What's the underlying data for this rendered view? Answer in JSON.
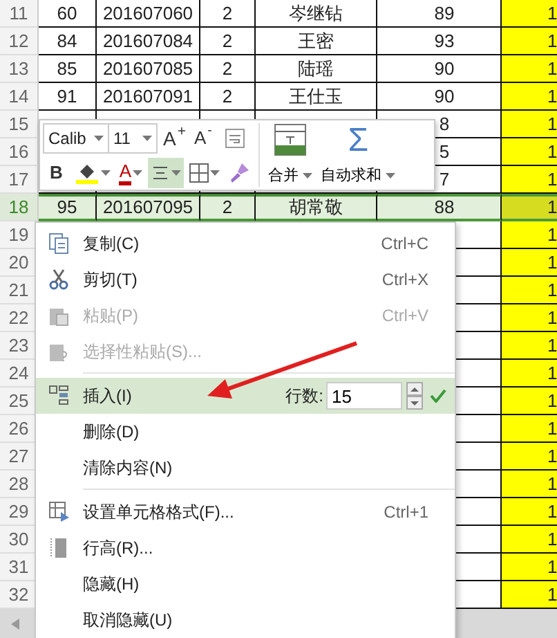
{
  "sheet": {
    "rows": [
      {
        "number": "11",
        "selected": false,
        "cells": {
          "a": "60",
          "b": "201607060",
          "c": "2",
          "d": "岑继钻",
          "e": "89",
          "f": "1"
        }
      },
      {
        "number": "12",
        "selected": false,
        "cells": {
          "a": "84",
          "b": "201607084",
          "c": "2",
          "d": "王密",
          "e": "93",
          "f": "1"
        }
      },
      {
        "number": "13",
        "selected": false,
        "cells": {
          "a": "85",
          "b": "201607085",
          "c": "2",
          "d": "陆瑶",
          "e": "90",
          "f": "1"
        }
      },
      {
        "number": "14",
        "selected": false,
        "cells": {
          "a": "91",
          "b": "201607091",
          "c": "2",
          "d": "王仕玉",
          "e": "90",
          "f": "1"
        }
      },
      {
        "number": "15",
        "selected": false,
        "cells": {
          "e": "8",
          "f": "1"
        }
      },
      {
        "number": "16",
        "selected": false,
        "cells": {
          "e": "5",
          "f": "1"
        }
      },
      {
        "number": "17",
        "selected": false,
        "cells": {
          "e": "7",
          "f": "1"
        }
      },
      {
        "number": "18",
        "selected": true,
        "cells": {
          "a": "95",
          "b": "201607095",
          "c": "2",
          "d": "胡常敬",
          "e": "88",
          "f": "1"
        }
      },
      {
        "number": "19",
        "selected": false,
        "cells": {
          "f": "1"
        }
      },
      {
        "number": "20",
        "selected": false,
        "cells": {
          "f": "1"
        }
      },
      {
        "number": "21",
        "selected": false,
        "cells": {
          "f": "1"
        }
      },
      {
        "number": "22",
        "selected": false,
        "cells": {
          "f": "1"
        }
      },
      {
        "number": "23",
        "selected": false,
        "cells": {
          "f": "1"
        }
      },
      {
        "number": "24",
        "selected": false,
        "cells": {
          "f": "1"
        }
      },
      {
        "number": "25",
        "selected": false,
        "cells": {
          "f": "1"
        }
      },
      {
        "number": "26",
        "selected": false,
        "cells": {
          "f": "1"
        }
      },
      {
        "number": "27",
        "selected": false,
        "cells": {
          "f": "1"
        }
      },
      {
        "number": "28",
        "selected": false,
        "cells": {
          "f": "1"
        }
      },
      {
        "number": "29",
        "selected": false,
        "cells": {
          "f": "1"
        }
      },
      {
        "number": "30",
        "selected": false,
        "cells": {
          "f": "1"
        }
      },
      {
        "number": "31",
        "selected": false,
        "cells": {
          "f": "1"
        }
      },
      {
        "number": "32",
        "selected": false,
        "cells": {
          "f": "1"
        }
      }
    ]
  },
  "toolbar": {
    "font_name": "Calib",
    "font_size": "11",
    "grow_font": "A$^{+}$",
    "shrink_font": "A$^{-}$",
    "bold": "B",
    "font_color": "A",
    "align_selected": true,
    "merge": "合并",
    "autosum_symbol": "Σ",
    "autosum": "自动求和"
  },
  "context_menu": {
    "items": [
      {
        "kind": "item",
        "label": "复制(C)",
        "shortcut": "Ctrl+C",
        "disabled": false,
        "selected": false
      },
      {
        "kind": "item",
        "label": "剪切(T)",
        "shortcut": "Ctrl+X",
        "disabled": false,
        "selected": false
      },
      {
        "kind": "item",
        "label": "粘贴(P)",
        "shortcut": "Ctrl+V",
        "disabled": true,
        "selected": false
      },
      {
        "kind": "item",
        "label": "选择性粘贴(S)...",
        "disabled": true,
        "selected": false
      },
      {
        "kind": "separator"
      },
      {
        "kind": "count",
        "label": "插入(I)",
        "count_label": "行数:",
        "count_value": "15",
        "disabled": false,
        "selected": true
      },
      {
        "kind": "item",
        "label": "删除(D)",
        "disabled": false,
        "selected": false
      },
      {
        "kind": "item",
        "label": "清除内容(N)",
        "disabled": false,
        "selected": false
      },
      {
        "kind": "separator"
      },
      {
        "kind": "item",
        "label": "设置单元格格式(F)...",
        "shortcut": "Ctrl+1",
        "disabled": false,
        "selected": false
      },
      {
        "kind": "item",
        "label": "行高(R)...",
        "disabled": false,
        "selected": false
      },
      {
        "kind": "item",
        "label": "隐藏(H)",
        "disabled": false,
        "selected": false
      },
      {
        "kind": "item",
        "label": "取消隐藏(U)",
        "disabled": false,
        "selected": false
      }
    ]
  }
}
